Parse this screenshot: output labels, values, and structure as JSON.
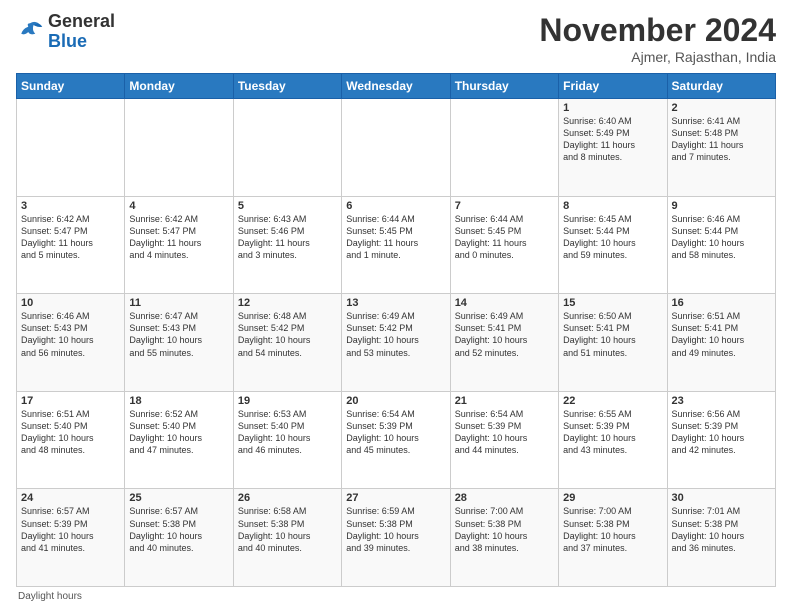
{
  "logo": {
    "general": "General",
    "blue": "Blue"
  },
  "header": {
    "month": "November 2024",
    "location": "Ajmer, Rajasthan, India"
  },
  "days_of_week": [
    "Sunday",
    "Monday",
    "Tuesday",
    "Wednesday",
    "Thursday",
    "Friday",
    "Saturday"
  ],
  "footer": {
    "note": "Daylight hours"
  },
  "weeks": [
    [
      {
        "day": "",
        "info": ""
      },
      {
        "day": "",
        "info": ""
      },
      {
        "day": "",
        "info": ""
      },
      {
        "day": "",
        "info": ""
      },
      {
        "day": "",
        "info": ""
      },
      {
        "day": "1",
        "info": "Sunrise: 6:40 AM\nSunset: 5:49 PM\nDaylight: 11 hours\nand 8 minutes."
      },
      {
        "day": "2",
        "info": "Sunrise: 6:41 AM\nSunset: 5:48 PM\nDaylight: 11 hours\nand 7 minutes."
      }
    ],
    [
      {
        "day": "3",
        "info": "Sunrise: 6:42 AM\nSunset: 5:47 PM\nDaylight: 11 hours\nand 5 minutes."
      },
      {
        "day": "4",
        "info": "Sunrise: 6:42 AM\nSunset: 5:47 PM\nDaylight: 11 hours\nand 4 minutes."
      },
      {
        "day": "5",
        "info": "Sunrise: 6:43 AM\nSunset: 5:46 PM\nDaylight: 11 hours\nand 3 minutes."
      },
      {
        "day": "6",
        "info": "Sunrise: 6:44 AM\nSunset: 5:45 PM\nDaylight: 11 hours\nand 1 minute."
      },
      {
        "day": "7",
        "info": "Sunrise: 6:44 AM\nSunset: 5:45 PM\nDaylight: 11 hours\nand 0 minutes."
      },
      {
        "day": "8",
        "info": "Sunrise: 6:45 AM\nSunset: 5:44 PM\nDaylight: 10 hours\nand 59 minutes."
      },
      {
        "day": "9",
        "info": "Sunrise: 6:46 AM\nSunset: 5:44 PM\nDaylight: 10 hours\nand 58 minutes."
      }
    ],
    [
      {
        "day": "10",
        "info": "Sunrise: 6:46 AM\nSunset: 5:43 PM\nDaylight: 10 hours\nand 56 minutes."
      },
      {
        "day": "11",
        "info": "Sunrise: 6:47 AM\nSunset: 5:43 PM\nDaylight: 10 hours\nand 55 minutes."
      },
      {
        "day": "12",
        "info": "Sunrise: 6:48 AM\nSunset: 5:42 PM\nDaylight: 10 hours\nand 54 minutes."
      },
      {
        "day": "13",
        "info": "Sunrise: 6:49 AM\nSunset: 5:42 PM\nDaylight: 10 hours\nand 53 minutes."
      },
      {
        "day": "14",
        "info": "Sunrise: 6:49 AM\nSunset: 5:41 PM\nDaylight: 10 hours\nand 52 minutes."
      },
      {
        "day": "15",
        "info": "Sunrise: 6:50 AM\nSunset: 5:41 PM\nDaylight: 10 hours\nand 51 minutes."
      },
      {
        "day": "16",
        "info": "Sunrise: 6:51 AM\nSunset: 5:41 PM\nDaylight: 10 hours\nand 49 minutes."
      }
    ],
    [
      {
        "day": "17",
        "info": "Sunrise: 6:51 AM\nSunset: 5:40 PM\nDaylight: 10 hours\nand 48 minutes."
      },
      {
        "day": "18",
        "info": "Sunrise: 6:52 AM\nSunset: 5:40 PM\nDaylight: 10 hours\nand 47 minutes."
      },
      {
        "day": "19",
        "info": "Sunrise: 6:53 AM\nSunset: 5:40 PM\nDaylight: 10 hours\nand 46 minutes."
      },
      {
        "day": "20",
        "info": "Sunrise: 6:54 AM\nSunset: 5:39 PM\nDaylight: 10 hours\nand 45 minutes."
      },
      {
        "day": "21",
        "info": "Sunrise: 6:54 AM\nSunset: 5:39 PM\nDaylight: 10 hours\nand 44 minutes."
      },
      {
        "day": "22",
        "info": "Sunrise: 6:55 AM\nSunset: 5:39 PM\nDaylight: 10 hours\nand 43 minutes."
      },
      {
        "day": "23",
        "info": "Sunrise: 6:56 AM\nSunset: 5:39 PM\nDaylight: 10 hours\nand 42 minutes."
      }
    ],
    [
      {
        "day": "24",
        "info": "Sunrise: 6:57 AM\nSunset: 5:39 PM\nDaylight: 10 hours\nand 41 minutes."
      },
      {
        "day": "25",
        "info": "Sunrise: 6:57 AM\nSunset: 5:38 PM\nDaylight: 10 hours\nand 40 minutes."
      },
      {
        "day": "26",
        "info": "Sunrise: 6:58 AM\nSunset: 5:38 PM\nDaylight: 10 hours\nand 40 minutes."
      },
      {
        "day": "27",
        "info": "Sunrise: 6:59 AM\nSunset: 5:38 PM\nDaylight: 10 hours\nand 39 minutes."
      },
      {
        "day": "28",
        "info": "Sunrise: 7:00 AM\nSunset: 5:38 PM\nDaylight: 10 hours\nand 38 minutes."
      },
      {
        "day": "29",
        "info": "Sunrise: 7:00 AM\nSunset: 5:38 PM\nDaylight: 10 hours\nand 37 minutes."
      },
      {
        "day": "30",
        "info": "Sunrise: 7:01 AM\nSunset: 5:38 PM\nDaylight: 10 hours\nand 36 minutes."
      }
    ]
  ]
}
